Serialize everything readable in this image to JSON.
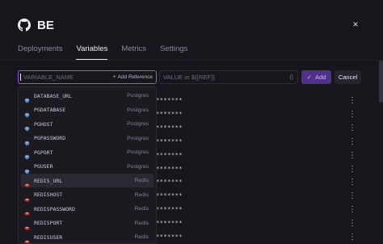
{
  "header": {
    "title": "BE",
    "icon": "github-icon",
    "close_icon": "close-icon",
    "close_glyph": "×"
  },
  "tabs": [
    {
      "label": "Deployments",
      "active": false
    },
    {
      "label": "Variables",
      "active": true
    },
    {
      "label": "Metrics",
      "active": false
    },
    {
      "label": "Settings",
      "active": false
    }
  ],
  "new_variable": {
    "name_placeholder": "VARIABLE_NAME",
    "add_reference_label": "Add Reference",
    "value_placeholder": "VALUE or ${{REF}}",
    "braces_glyph": "{}",
    "add_label": "Add",
    "cancel_label": "Cancel"
  },
  "variables": {
    "masked_value": "*******",
    "row_count": 11
  },
  "reference_dropdown": {
    "items": [
      {
        "name": "DATABASE_URL",
        "service": "Postgres",
        "icon": "postgres-icon"
      },
      {
        "name": "PGDATABASE",
        "service": "Postgres",
        "icon": "postgres-icon"
      },
      {
        "name": "PGHOST",
        "service": "Postgres",
        "icon": "postgres-icon"
      },
      {
        "name": "PGPASSWORD",
        "service": "Postgres",
        "icon": "postgres-icon"
      },
      {
        "name": "PGPORT",
        "service": "Postgres",
        "icon": "postgres-icon"
      },
      {
        "name": "PGUSER",
        "service": "Postgres",
        "icon": "postgres-icon"
      },
      {
        "name": "REDIS_URL",
        "service": "Redis",
        "icon": "redis-icon",
        "highlighted": true
      },
      {
        "name": "REDISHOST",
        "service": "Redis",
        "icon": "redis-icon"
      },
      {
        "name": "REDISPASSWORD",
        "service": "Redis",
        "icon": "redis-icon"
      },
      {
        "name": "REDISPORT",
        "service": "Redis",
        "icon": "redis-icon"
      },
      {
        "name": "REDISUSER",
        "service": "Redis",
        "icon": "redis-icon"
      }
    ]
  },
  "colors": {
    "accent": "#8f59e6",
    "postgres": "#5b8fc6",
    "redis": "#d8423a",
    "background": "#17161d"
  }
}
